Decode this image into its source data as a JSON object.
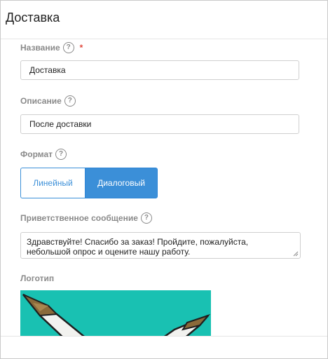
{
  "header": {
    "title": "Доставка"
  },
  "form": {
    "name": {
      "label": "Название",
      "help": "?",
      "required_mark": "*",
      "value": "Доставка"
    },
    "description": {
      "label": "Описание",
      "help": "?",
      "value": "После доставки"
    },
    "format": {
      "label": "Формат",
      "help": "?",
      "options": [
        "Линейный",
        "Диалоговый"
      ],
      "selected": "Диалоговый"
    },
    "greeting": {
      "label": "Приветственное сообщение",
      "help": "?",
      "line1": "Здравствуйте! Спасибо за заказ! Пройдите, пожалуйста,",
      "line2": "небольшой опрос и оцените нашу работу."
    },
    "logo": {
      "label": "Логотип",
      "icon": "bird-logo-icon",
      "background_color": "#19c1b2"
    }
  },
  "colors": {
    "accent": "#3b8fd8",
    "required": "#e0463a",
    "label": "#8a8a8a"
  }
}
